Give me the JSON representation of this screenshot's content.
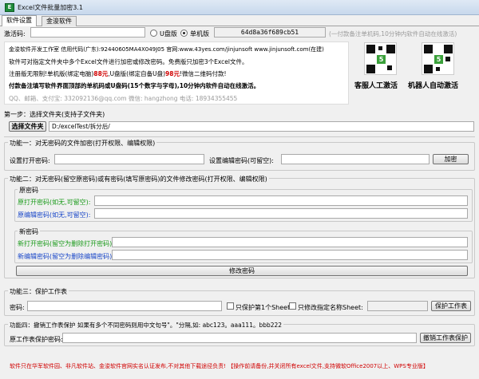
{
  "window": {
    "title": "Excel文件批量加密3.1",
    "icon_text": "E"
  },
  "tabs": [
    {
      "label": "软件设置",
      "active": true
    },
    {
      "label": "金浚软件",
      "active": false
    }
  ],
  "activation": {
    "label": "激活码:",
    "code_value": "",
    "modes": [
      {
        "label": "U盘版",
        "selected": false
      },
      {
        "label": "单机版",
        "selected": true
      }
    ],
    "machine_code": "64d8a36f689cb51",
    "hint": "(一付款备注单机码,10分钟内软件自动在线激活)"
  },
  "info": {
    "line1": "金浚软件开发工作室 信用代码(广东):92440605MA4X049J05 官网:www.43yes.com/jinjunsoft  www.jinjunsoft.com(在建)",
    "line2": "软件可对指定文件夹中多个Excel文件进行加密或修改密码。免费版只加密3个Excel文件。",
    "line3_a": "注册版无限制!单机版(绑定电脑)",
    "line3_price1": "88元",
    "line3_b": ",U盘版(绑定自备U盘)",
    "line3_price2": "98元",
    "line3_c": "!微信二维码付款!",
    "line4": "付款备注填写软件界面顶部的单机码或U盘码(15个数字与字母),10分钟内软件自动在线激活。",
    "line5": "QQ、邮箱、支付宝: 332092136@qq.com   微信: hangzhong   电话: 18934355455"
  },
  "qr": [
    {
      "caption": "客服人工激活",
      "icon": "qr-code-icon"
    },
    {
      "caption": "机器人自动激活",
      "icon": "qr-code-icon"
    }
  ],
  "step1": {
    "title": "第一步：选择文件夹(支持子文件夹)",
    "button": "选择文件夹",
    "path": "D:/excelTest/拆分后/"
  },
  "func1": {
    "title": "功能一：对无密码的文件加密(打开权限、编辑权限)",
    "open_label": "设置打开密码:",
    "edit_label": "设置编辑密码(可留空):",
    "button": "加密"
  },
  "func2": {
    "title": "功能二：对无密码(留空原密码)或有密码(填写原密码)的文件修改密码(打开权限、编辑权限)",
    "orig_title": "原密码",
    "orig_open": "原打开密码(如无,可留空):",
    "orig_edit": "原编辑密码(如无,可留空):",
    "new_title": "新密码",
    "new_open": "新打开密码(留空为删除打开密码):",
    "new_edit": "新编辑密码(留空为删除编辑密码):",
    "button": "修改密码"
  },
  "func3": {
    "title": "功能三：保护工作表",
    "pwd_label": "密码:",
    "check1": "只保护第1个Sheet",
    "check2": "只修改指定名称Sheet:",
    "button": "保护工作表"
  },
  "func4": {
    "title": "功能四：撤销工作表保护  如果有多个不同密码则用中文句号\"。\"分隔,如: abc123。aaa111。bbb222",
    "pwd_label": "原工作表保护密码:",
    "button": "撤销工作表保护"
  },
  "footer": {
    "a": "软件只在华军软件园、非凡软件站、金浚软件官网实名认证发布,不对其他下载途径负责!",
    "b": "【操作前请备份,并关闭所有excel文件,支持微软Office2007以上、WPS专业版】"
  },
  "colors": {
    "red": "#d00000",
    "green": "#1a9a1a",
    "blue": "#1846c8",
    "grey": "#9a9a9a"
  }
}
